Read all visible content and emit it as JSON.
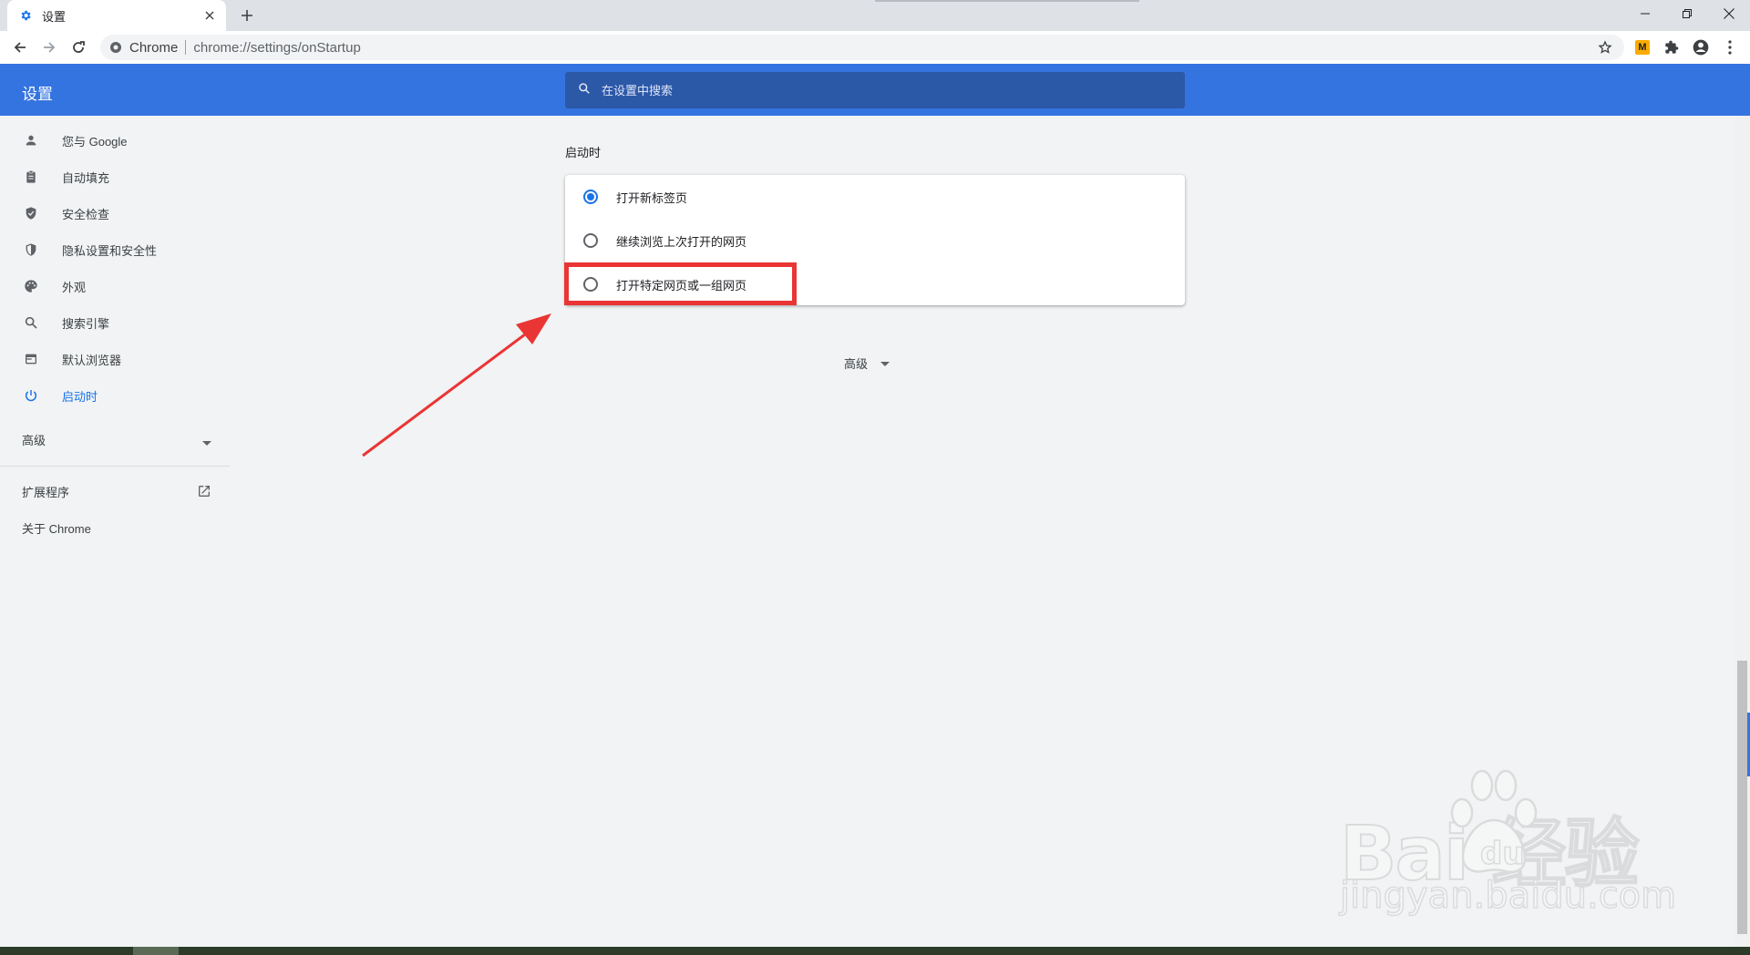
{
  "browser": {
    "tab_title": "设置",
    "omnibox_site": "Chrome",
    "omnibox_url": "chrome://settings/onStartup",
    "extension_badge": "M"
  },
  "header": {
    "title": "设置",
    "search_placeholder": "在设置中搜索"
  },
  "sidebar": {
    "items": [
      {
        "label": "您与 Google",
        "icon": "person-icon"
      },
      {
        "label": "自动填充",
        "icon": "clipboard-icon"
      },
      {
        "label": "安全检查",
        "icon": "shield-check-icon"
      },
      {
        "label": "隐私设置和安全性",
        "icon": "shield-icon"
      },
      {
        "label": "外观",
        "icon": "palette-icon"
      },
      {
        "label": "搜索引擎",
        "icon": "search-icon"
      },
      {
        "label": "默认浏览器",
        "icon": "browser-icon"
      },
      {
        "label": "启动时",
        "icon": "power-icon",
        "active": true
      }
    ],
    "advanced_label": "高级",
    "extensions_label": "扩展程序",
    "about_label": "关于 Chrome"
  },
  "main": {
    "section_title": "启动时",
    "options": [
      {
        "label": "打开新标签页",
        "checked": true
      },
      {
        "label": "继续浏览上次打开的网页",
        "checked": false
      },
      {
        "label": "打开特定网页或一组网页",
        "checked": false
      }
    ],
    "advanced_label": "高级"
  },
  "watermark": {
    "brand": "Bai  经验",
    "url": "jingyan.baidu.com"
  },
  "colors": {
    "header_blue": "#3474e0",
    "accent": "#1a73e8",
    "highlight_red": "#ea3535"
  }
}
